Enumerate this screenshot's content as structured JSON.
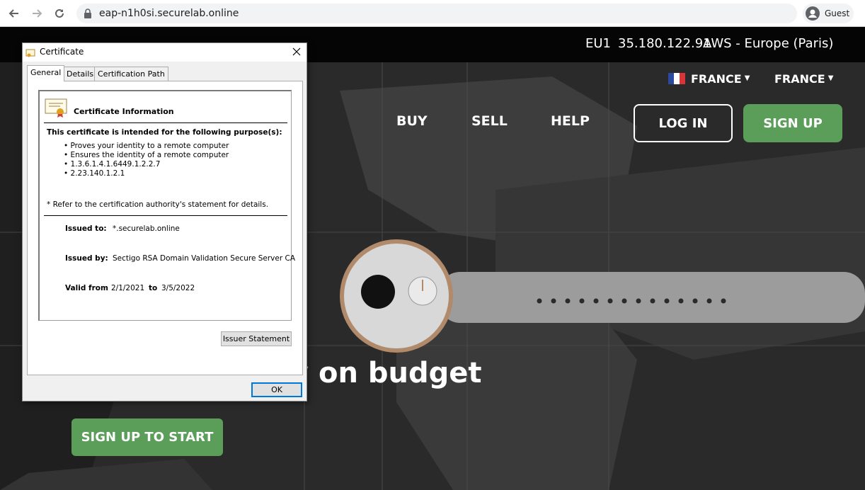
{
  "browser": {
    "url": "eap-n1h0si.securelab.online",
    "profile": "Guest"
  },
  "site": {
    "env": {
      "region": "EU1",
      "ip": "35.180.122.91",
      "host": "AWS - Europe (Paris)"
    },
    "lang1": "FRANCE",
    "lang2": "FRANCE",
    "nav": {
      "buy": "BUY",
      "sell": "SELL",
      "help": "HELP"
    },
    "login": "LOG IN",
    "signup": "SIGN UP",
    "hero": "y on budget",
    "cta": "SIGN UP TO START"
  },
  "dialog": {
    "title": "Certificate",
    "tabs": [
      "General",
      "Details",
      "Certification Path"
    ],
    "info_title": "Certificate Information",
    "purpose_heading": "This certificate is intended for the following purpose(s):",
    "purposes": [
      "Proves your identity to a remote computer",
      "Ensures the identity of a remote computer",
      "1.3.6.1.4.1.6449.1.2.2.7",
      "2.23.140.1.2.1"
    ],
    "note": "Refer to the certification authority's statement for details.",
    "issued_to_label": "Issued to:",
    "issued_to": "*.securelab.online",
    "issued_by_label": "Issued by:",
    "issued_by": "Sectigo RSA Domain Validation Secure Server CA",
    "valid_from_label": "Valid from",
    "valid_from": "2/1/2021",
    "valid_to_label": "to",
    "valid_to": "3/5/2022",
    "issuer_button": "Issuer Statement",
    "ok_button": "OK"
  },
  "colors": {
    "accent_green": "#5a9e5a",
    "dialog_bg": "#f0f0f0"
  }
}
